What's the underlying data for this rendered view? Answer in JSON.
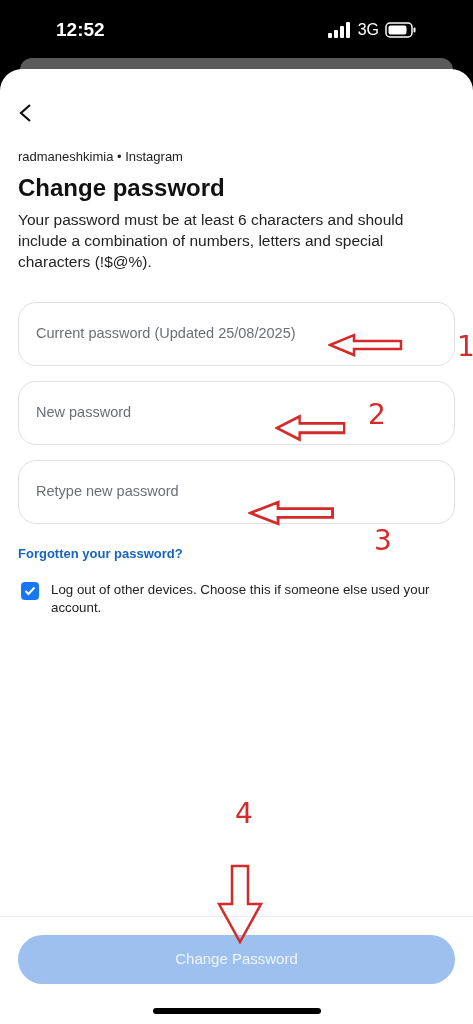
{
  "status_bar": {
    "time": "12:52",
    "network": "3G"
  },
  "header": {
    "account": "radmaneshkimia • Instagram",
    "title": "Change password",
    "description": "Your password must be at least 6 characters and should include a combination of numbers, letters and special characters (!$@%)."
  },
  "fields": [
    {
      "placeholder": "Current password (Updated 25/08/2025)"
    },
    {
      "placeholder": "New password"
    },
    {
      "placeholder": "Retype new password"
    }
  ],
  "forgot_link": "Forgotten your password?",
  "logout_option": {
    "label": "Log out of other devices. Choose this if someone else used your account.",
    "checked": true
  },
  "submit_button": {
    "label": "Change Password",
    "disabled": true
  },
  "annotations": [
    {
      "kind": "left",
      "number": "1"
    },
    {
      "kind": "left",
      "number": "2"
    },
    {
      "kind": "left",
      "number": "3"
    },
    {
      "kind": "down",
      "number": "4"
    }
  ]
}
